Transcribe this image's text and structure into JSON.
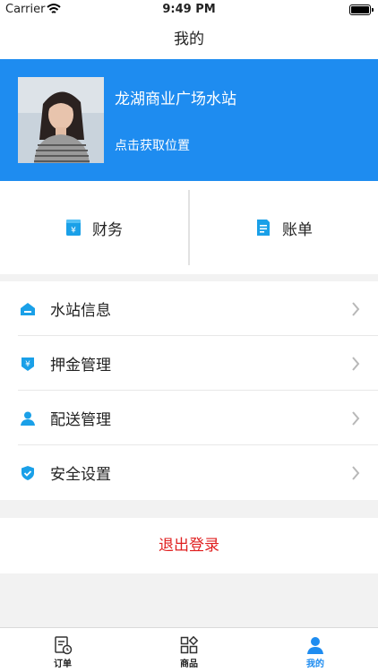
{
  "status_bar": {
    "carrier": "Carrier",
    "time": "9:49 PM",
    "battery_level": 1.0
  },
  "nav": {
    "title": "我的"
  },
  "profile": {
    "name": "龙湖商业广场水站",
    "location_prompt": "点击获取位置",
    "background_color": "#1e8cf0"
  },
  "quick_actions": [
    {
      "label": "财务",
      "icon": "wallet-yen-icon"
    },
    {
      "label": "账单",
      "icon": "bill-document-icon"
    }
  ],
  "menu": [
    {
      "label": "水站信息",
      "icon": "station-home-icon"
    },
    {
      "label": "押金管理",
      "icon": "deposit-yen-icon"
    },
    {
      "label": "配送管理",
      "icon": "delivery-person-icon"
    },
    {
      "label": "安全设置",
      "icon": "security-shield-icon"
    }
  ],
  "logout": {
    "label": "退出登录",
    "color": "#e02020"
  },
  "tab_bar": {
    "items": [
      {
        "label": "订单",
        "icon": "order-list-icon",
        "active": false
      },
      {
        "label": "商品",
        "icon": "goods-grid-icon",
        "active": false
      },
      {
        "label": "我的",
        "icon": "profile-person-icon",
        "active": true
      }
    ],
    "active_color": "#1e8cf0"
  },
  "accent_icon_color": "#1aa0e8"
}
